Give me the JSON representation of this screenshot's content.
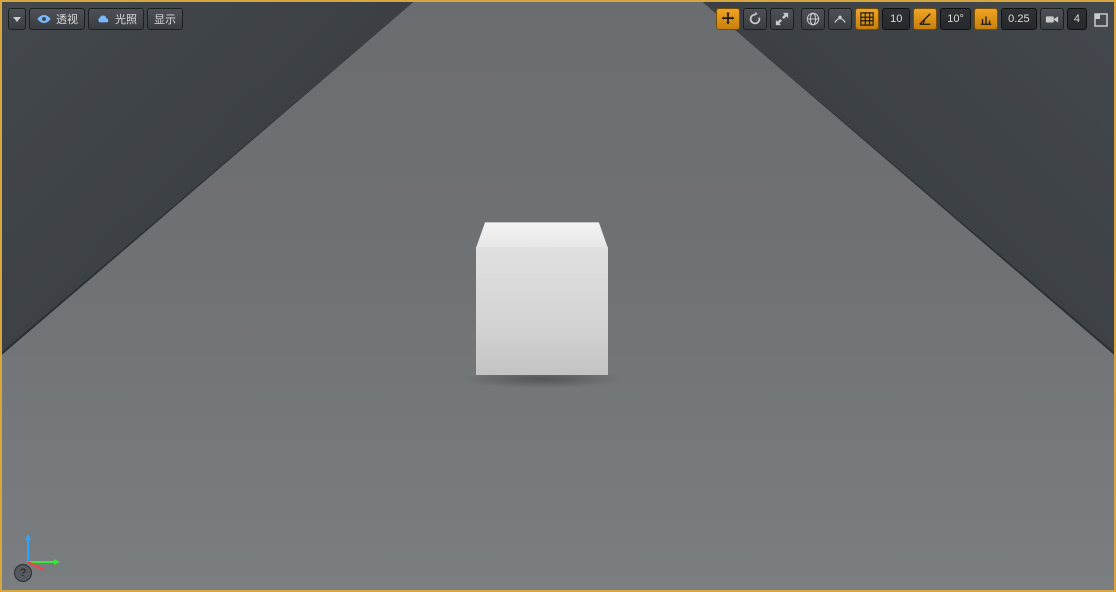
{
  "toolbar": {
    "left": {
      "dropdown": {
        "caret": "▾"
      },
      "perspective": {
        "label": "透视"
      },
      "lighting": {
        "label": "光照"
      },
      "show": {
        "label": "显示"
      }
    },
    "right": {
      "move": {
        "name": "move-gizmo"
      },
      "rotate": {
        "name": "rotate-gizmo"
      },
      "scale": {
        "name": "scale-gizmo"
      },
      "world": {
        "name": "world-local-toggle"
      },
      "surface_snap": {
        "name": "surface-snap"
      },
      "grid_snap": {
        "name": "grid-snap-toggle"
      },
      "grid_value": "10",
      "angle_snap": {
        "name": "angle-snap-toggle"
      },
      "angle_value": "10°",
      "scale_snap": {
        "name": "scale-snap-toggle"
      },
      "scale_value": "0.25",
      "camera_speed": {
        "name": "camera-speed"
      },
      "camera_value": "4",
      "maximize": {
        "name": "maximize-viewport"
      }
    }
  },
  "axis": {
    "x": "x",
    "y": "y",
    "z": "z"
  },
  "help": {
    "label": "?"
  }
}
